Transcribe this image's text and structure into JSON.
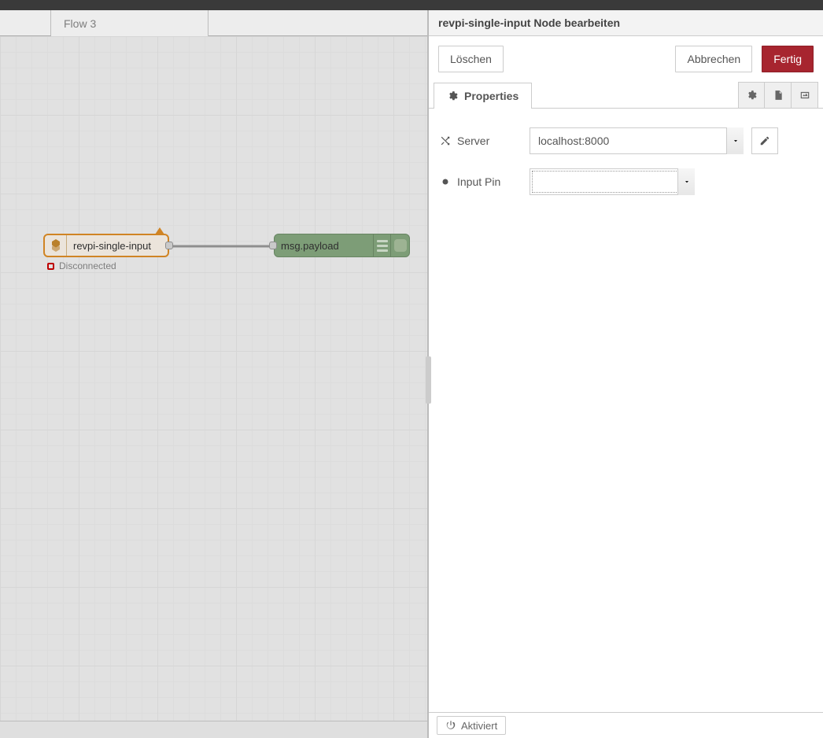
{
  "tabs": {
    "flow_name": "Flow 3"
  },
  "nodes": {
    "input_label": "revpi-single-input",
    "input_status": "Disconnected",
    "debug_label": "msg.payload"
  },
  "tray": {
    "title": "revpi-single-input Node bearbeiten",
    "buttons": {
      "delete": "Löschen",
      "cancel": "Abbrechen",
      "done": "Fertig"
    },
    "properties_tab": "Properties",
    "form": {
      "server_label": "Server",
      "server_value": "localhost:8000",
      "inputpin_label": "Input Pin",
      "inputpin_value": ""
    },
    "footer": {
      "enabled_label": "Aktiviert"
    }
  }
}
